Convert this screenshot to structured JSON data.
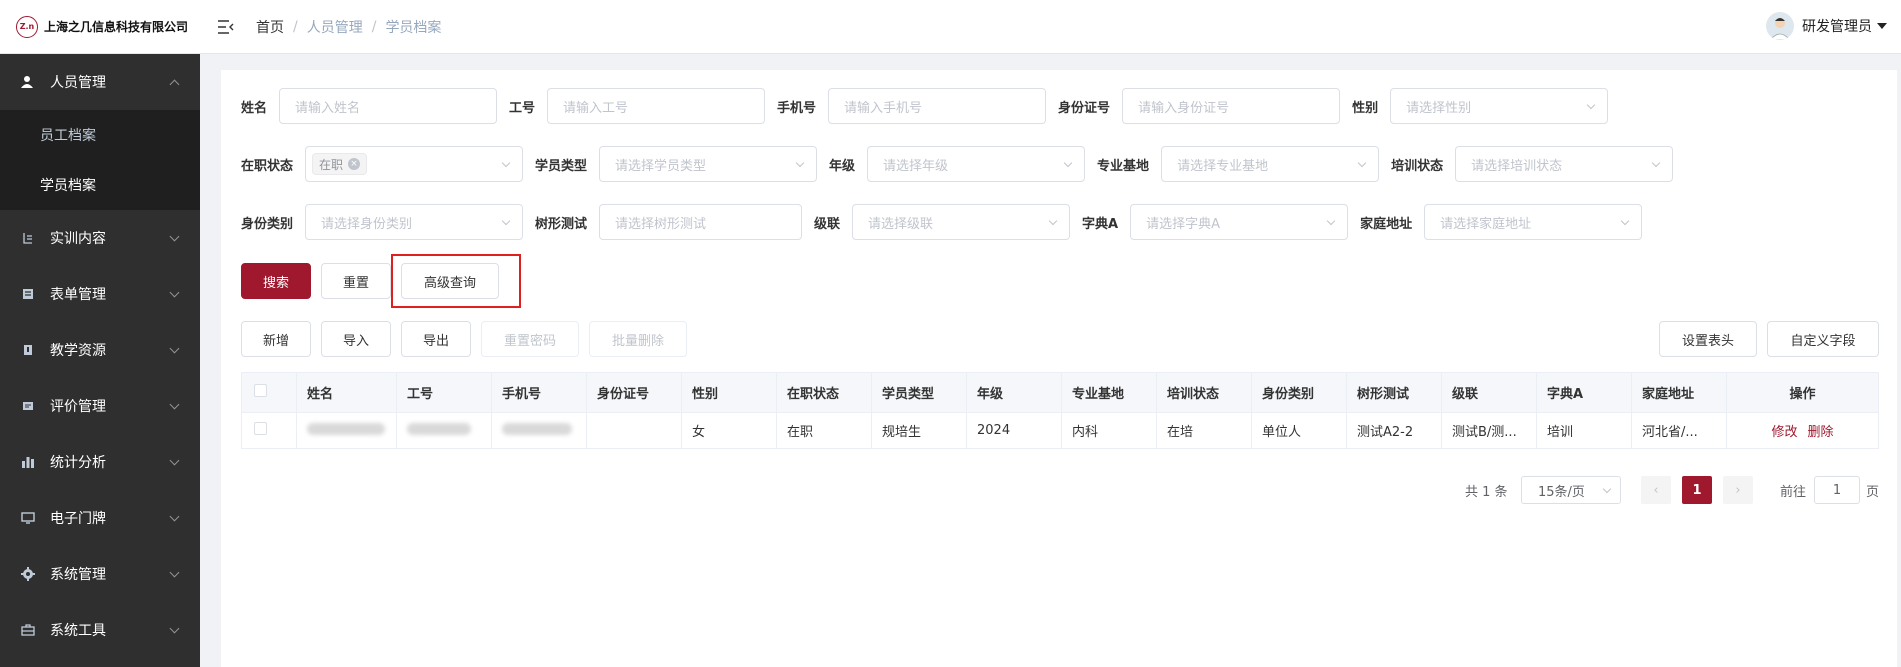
{
  "header": {
    "logo_mark": "Z.n",
    "company": "上海之几信息科技有限公司",
    "breadcrumb": [
      "首页",
      "人员管理",
      "学员档案"
    ],
    "user_name": "研发管理员"
  },
  "sidebar": {
    "items": [
      {
        "label": "人员管理",
        "icon": "users-icon",
        "expanded": true
      },
      {
        "label": "实训内容",
        "icon": "training-icon"
      },
      {
        "label": "表单管理",
        "icon": "form-icon"
      },
      {
        "label": "教学资源",
        "icon": "book-icon"
      },
      {
        "label": "评价管理",
        "icon": "evaluation-icon"
      },
      {
        "label": "统计分析",
        "icon": "chart-icon"
      },
      {
        "label": "电子门牌",
        "icon": "monitor-icon"
      },
      {
        "label": "系统管理",
        "icon": "gear-icon"
      },
      {
        "label": "系统工具",
        "icon": "toolbox-icon"
      }
    ],
    "sub_items": [
      "员工档案",
      "学员档案"
    ],
    "active_sub": "学员档案"
  },
  "filters": {
    "name": {
      "label": "姓名",
      "placeholder": "请输入姓名"
    },
    "job_no": {
      "label": "工号",
      "placeholder": "请输入工号"
    },
    "phone": {
      "label": "手机号",
      "placeholder": "请输入手机号"
    },
    "id_card": {
      "label": "身份证号",
      "placeholder": "请输入身份证号"
    },
    "gender": {
      "label": "性别",
      "placeholder": "请选择性别"
    },
    "status": {
      "label": "在职状态",
      "tag": "在职"
    },
    "student_type": {
      "label": "学员类型",
      "placeholder": "请选择学员类型"
    },
    "grade": {
      "label": "年级",
      "placeholder": "请选择年级"
    },
    "base": {
      "label": "专业基地",
      "placeholder": "请选择专业基地"
    },
    "train_status": {
      "label": "培训状态",
      "placeholder": "请选择培训状态"
    },
    "identity": {
      "label": "身份类别",
      "placeholder": "请选择身份类别"
    },
    "tree_test": {
      "label": "树形测试",
      "placeholder": "请选择树形测试"
    },
    "cascade": {
      "label": "级联",
      "placeholder": "请选择级联"
    },
    "dict_a": {
      "label": "字典A",
      "placeholder": "请选择字典A"
    },
    "address": {
      "label": "家庭地址",
      "placeholder": "请选择家庭地址"
    }
  },
  "buttons": {
    "search": "搜索",
    "reset": "重置",
    "advanced": "高级查询",
    "add": "新增",
    "import": "导入",
    "export": "导出",
    "reset_pwd": "重置密码",
    "batch_delete": "批量删除",
    "set_header": "设置表头",
    "custom_field": "自定义字段"
  },
  "table": {
    "columns": [
      "姓名",
      "工号",
      "手机号",
      "身份证号",
      "性别",
      "在职状态",
      "学员类型",
      "年级",
      "专业基地",
      "培训状态",
      "身份类别",
      "树形测试",
      "级联",
      "字典A",
      "家庭地址",
      "操作"
    ],
    "rows": [
      {
        "gender": "女",
        "status": "在职",
        "type": "规培生",
        "grade": "2024",
        "base": "内科",
        "train": "在培",
        "identity": "单位人",
        "tree": "测试A2-2",
        "cascade": "测试B/测...",
        "dict": "培训",
        "address": "河北省/...",
        "edit": "修改",
        "delete": "删除"
      }
    ]
  },
  "pagination": {
    "total": "共 1 条",
    "page_size": "15条/页",
    "current": "1",
    "goto_label": "前往",
    "goto_value": "1",
    "page_suffix": "页"
  },
  "colors": {
    "brand": "#a0182e",
    "sidebar": "#2f2f30",
    "highlight": "#e0201e"
  }
}
